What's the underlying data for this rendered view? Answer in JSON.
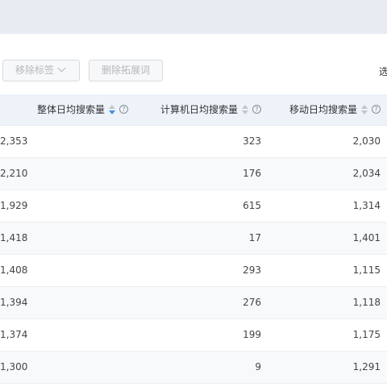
{
  "toolbar": {
    "remove_tags_label": "移除标签",
    "delete_expansion_label": "删除拓展词",
    "edge_text": "选"
  },
  "table": {
    "columns": [
      {
        "label": "整体日均搜索量",
        "sort": "desc"
      },
      {
        "label": "计算机日均搜索量",
        "sort": "none"
      },
      {
        "label": "移动日均搜索量",
        "sort": "none"
      }
    ],
    "rows": [
      {
        "overall": "2,353",
        "pc": "323",
        "mobile": "2,030"
      },
      {
        "overall": "2,210",
        "pc": "176",
        "mobile": "2,034"
      },
      {
        "overall": "1,929",
        "pc": "615",
        "mobile": "1,314"
      },
      {
        "overall": "1,418",
        "pc": "17",
        "mobile": "1,401"
      },
      {
        "overall": "1,408",
        "pc": "293",
        "mobile": "1,115"
      },
      {
        "overall": "1,394",
        "pc": "276",
        "mobile": "1,118"
      },
      {
        "overall": "1,374",
        "pc": "199",
        "mobile": "1,175"
      },
      {
        "overall": "1,300",
        "pc": "9",
        "mobile": "1,291"
      }
    ]
  },
  "colors": {
    "header_bg": "#eef3fa",
    "topbar_bg": "#e8ecf2",
    "sort_active": "#3f8ee8"
  }
}
